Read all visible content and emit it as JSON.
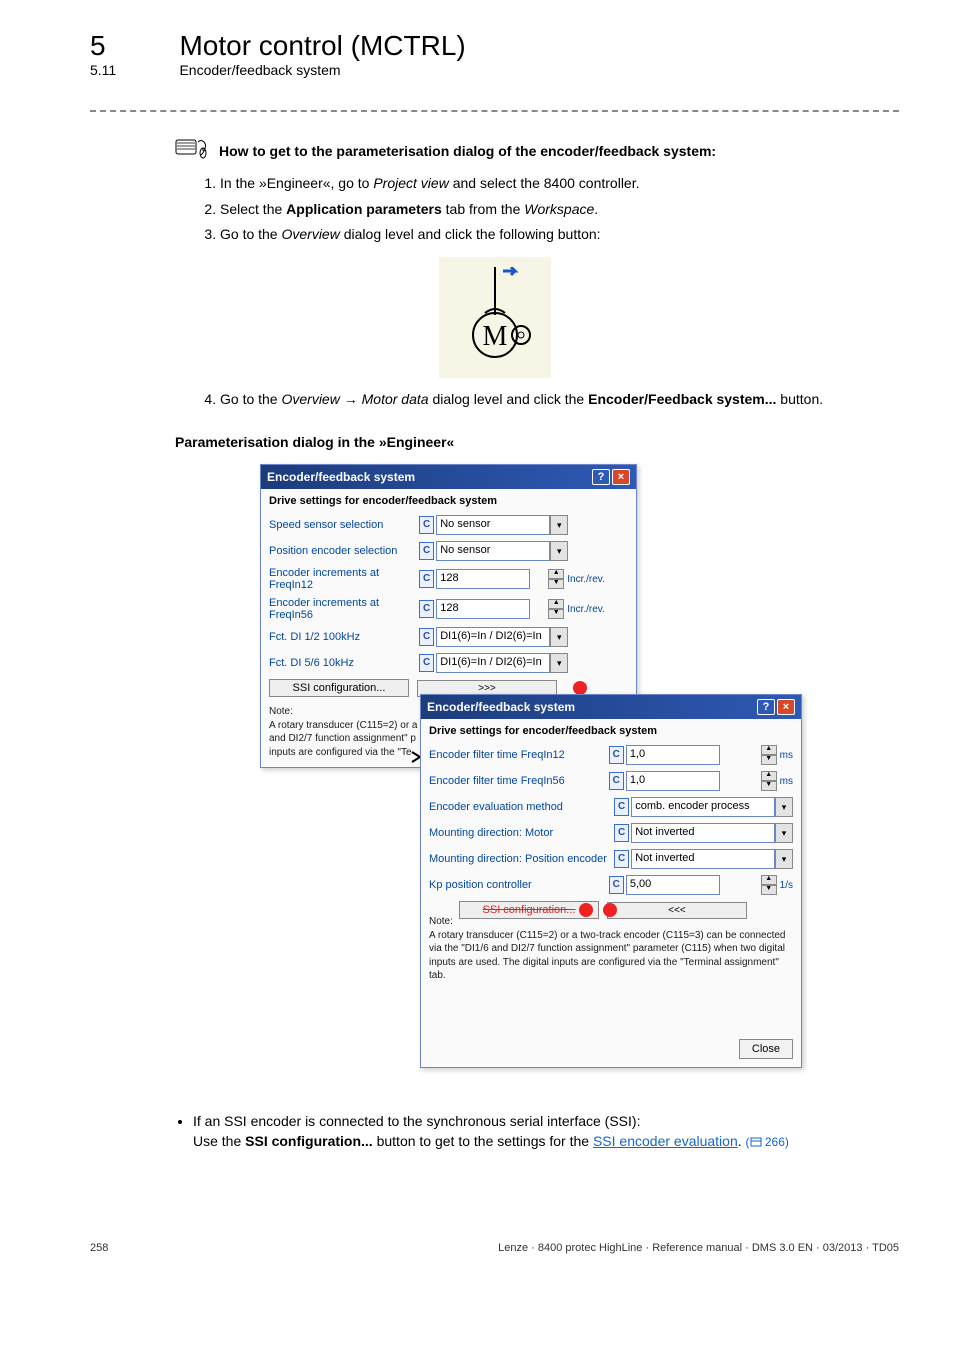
{
  "header": {
    "chapter_num": "5",
    "chapter_title": "Motor control (MCTRL)",
    "section_num": "5.11",
    "section_title": "Encoder/feedback system"
  },
  "navhint": {
    "heading": "How to get to the parameterisation dialog of the encoder/feedback system:",
    "steps": {
      "s1_pre": "In the »Engineer«, go to ",
      "s1_em": "Project view",
      "s1_post": " and select the 8400 controller.",
      "s2_pre": "Select the ",
      "s2_b": "Application parameters",
      "s2_mid": " tab from the ",
      "s2_em": "Workspace",
      "s2_post": ".",
      "s3_pre": "Go to the ",
      "s3_em": "Overview",
      "s3_post": " dialog level and click the following button:",
      "s4_pre": "Go to the ",
      "s4_em1": "Overview",
      "s4_arrow": " → ",
      "s4_em2": "Motor data",
      "s4_mid": " dialog level and click the ",
      "s4_b": "Encoder/Feedback system...",
      "s4_post": " button."
    }
  },
  "subheading": "Parameterisation dialog in the »Engineer«",
  "dialog1": {
    "title": "Encoder/feedback system",
    "section": "Drive settings for encoder/feedback system",
    "rows": {
      "speed_label": "Speed sensor selection",
      "speed_val": "No sensor",
      "pos_label": "Position encoder selection",
      "pos_val": "No sensor",
      "inc12_label": "Encoder increments at FreqIn12",
      "inc12_val": "128",
      "inc12_unit": "Incr./rev.",
      "inc56_label": "Encoder increments at FreqIn56",
      "inc56_val": "128",
      "inc56_unit": "Incr./rev.",
      "fct12_label": "Fct. DI 1/2 100kHz",
      "fct12_val": "DI1(6)=In / DI2(6)=In",
      "fct56_label": "Fct. DI 5/6 10kHz",
      "fct56_val": "DI1(6)=In / DI2(6)=In",
      "ssi_btn": "SSI configuration...",
      "expand_btn": ">>>"
    },
    "note": {
      "label": "Note:",
      "l1": "A rotary transducer (C115=2) or a",
      "l2": "and DI2/7 function assignment\" p",
      "l3": "inputs are configured via the \"Te"
    }
  },
  "dialog2": {
    "title": "Encoder/feedback system",
    "section": "Drive settings for encoder/feedback system",
    "rows": {
      "flt12_label": "Encoder filter time FreqIn12",
      "flt12_val": "1,0",
      "flt12_unit": "ms",
      "flt56_label": "Encoder filter time FreqIn56",
      "flt56_val": "1,0",
      "flt56_unit": "ms",
      "eval_label": "Encoder evaluation method",
      "eval_val": "comb. encoder process",
      "mnt_motor_label": "Mounting direction: Motor",
      "mnt_motor_val": "Not inverted",
      "mnt_pos_label": "Mounting direction: Position encoder",
      "mnt_pos_val": "Not inverted",
      "kp_label": "Kp position controller",
      "kp_val": "5,00",
      "kp_unit": "1/s",
      "ssi_btn": "SSI configuration...",
      "collapse_btn": "<<<"
    },
    "note": {
      "label": "Note:",
      "text": "A rotary transducer (C115=2) or a two-track encoder (C115=3) can be connected via the \"DI1/6 and DI2/7 function assignment\" parameter (C115) when two digital inputs are used. The digital inputs are configured via the \"Terminal assignment\" tab."
    },
    "close_btn": "Close"
  },
  "bottom_bullet": {
    "line1": "If an SSI encoder is connected to the synchronous serial interface (SSI):",
    "line2_pre": "Use the ",
    "line2_b": "SSI configuration...",
    "line2_mid": " button to get to the settings for the ",
    "link_text": "SSI encoder evaluation",
    "line2_post": ". ",
    "pageref": "266"
  },
  "footer": {
    "page": "258",
    "doc": "Lenze · 8400 protec HighLine · Reference manual · DMS 3.0 EN · 03/2013 · TD05"
  },
  "c_label": "C"
}
